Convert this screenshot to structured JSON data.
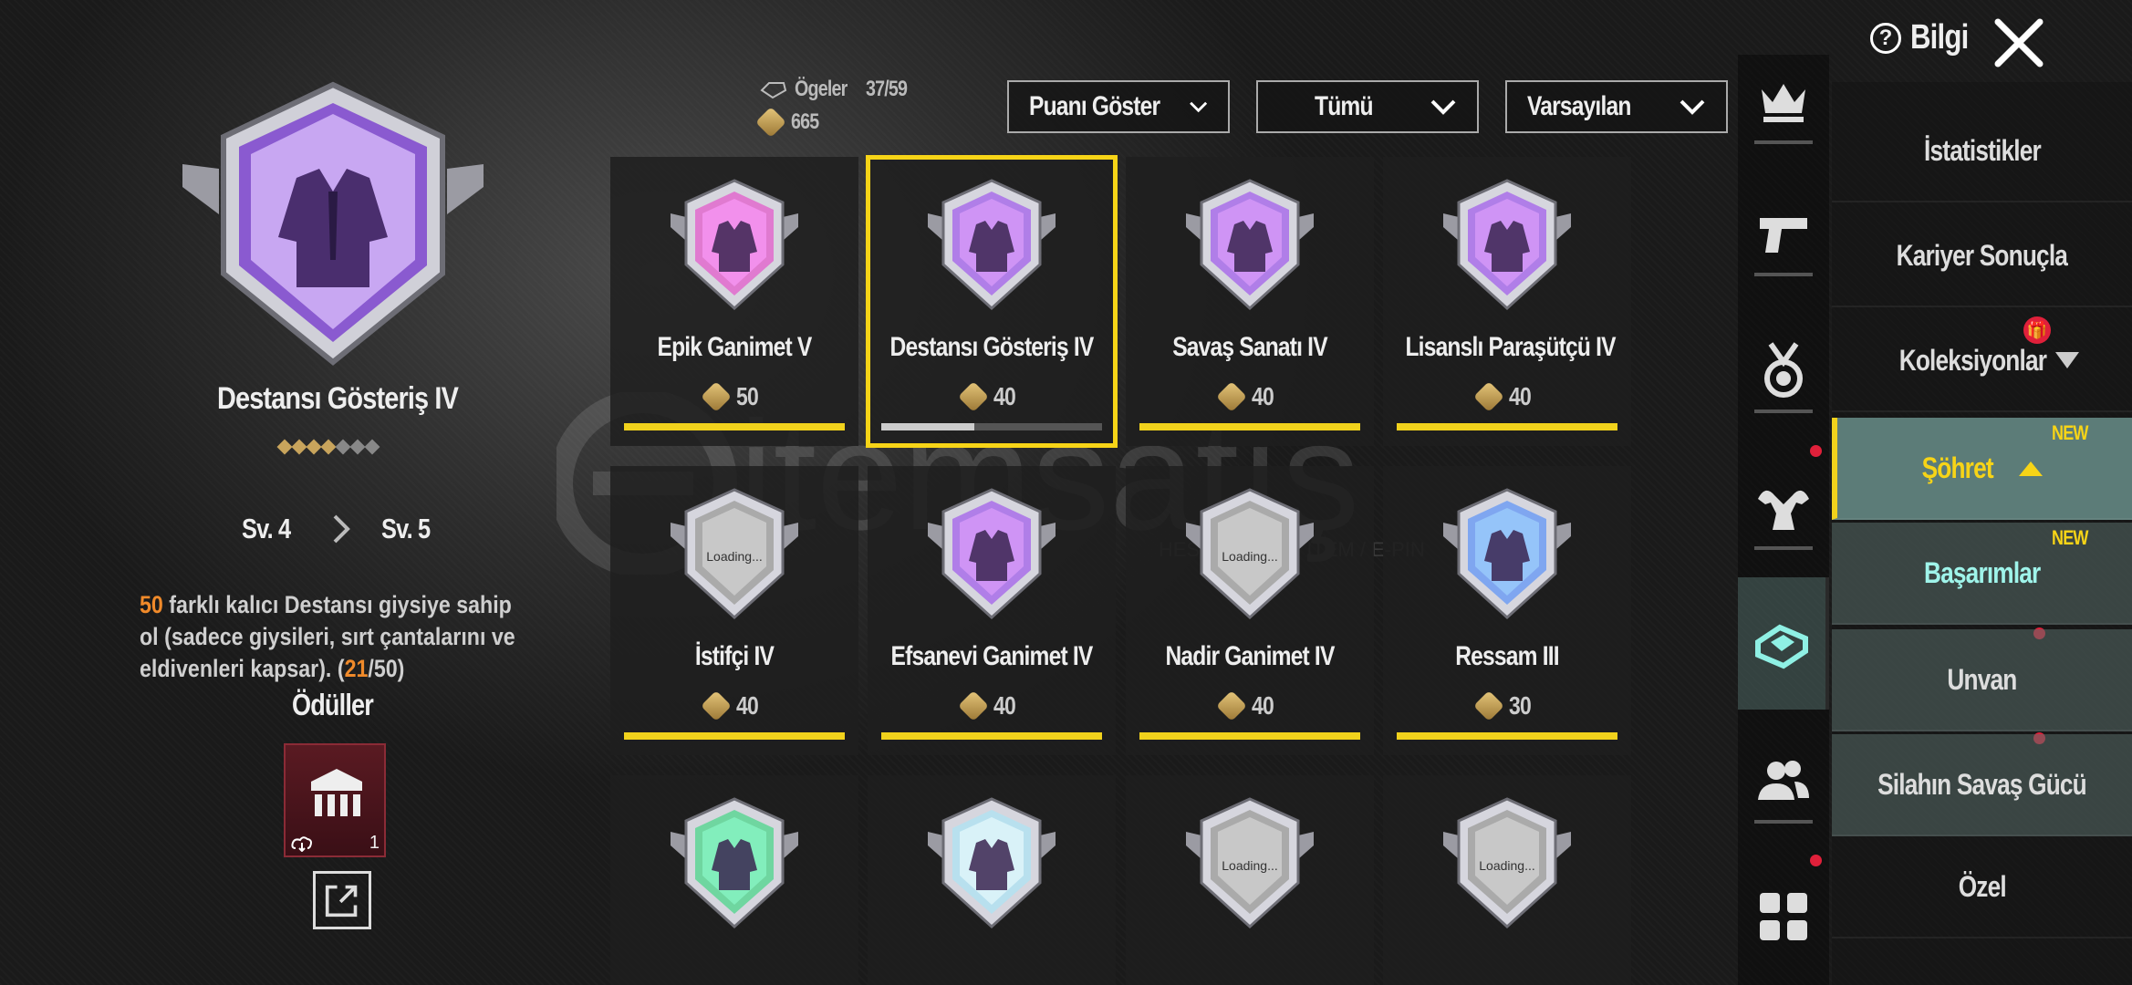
{
  "header": {
    "info_label": "Bilgi"
  },
  "selected": {
    "name": "Destansı Gösteriş IV",
    "level_from": "Sv. 4",
    "level_to": "Sv. 5",
    "desc_count": "50",
    "desc_text": " farklı kalıcı Destansı giysiye sahip ol (sadece giysileri, sırt çantalarını ve eldivenleri kapsar). (",
    "desc_progress": "21",
    "desc_total": "/50)",
    "rewards_title": "Ödüller",
    "reward_count": "1"
  },
  "stats": {
    "items_label": "Ögeler",
    "items_value": "37/59",
    "points_value": "665"
  },
  "filters": {
    "score": "Puanı Göster",
    "all": "Tümü",
    "sort": "Varsayılan"
  },
  "cards": [
    {
      "name": "Epik Ganimet V",
      "points": "50",
      "progress": 1.0,
      "color": "#e07ad0"
    },
    {
      "name": "Destansı Gösteriş IV",
      "points": "40",
      "progress": 0.42,
      "color": "#b07ee8"
    },
    {
      "name": "Savaş Sanatı IV",
      "points": "40",
      "progress": 1.0,
      "color": "#b07ee8"
    },
    {
      "name": "Lisanslı Paraşütçü IV",
      "points": "40",
      "progress": 1.0,
      "color": "#b07ee8"
    },
    {
      "name": "İstifçi IV",
      "points": "40",
      "progress": 1.0,
      "color": "#aaaaaa",
      "loading": "Loading..."
    },
    {
      "name": "Efsanevi Ganimet IV",
      "points": "40",
      "progress": 1.0,
      "color": "#b07ee8"
    },
    {
      "name": "Nadir Ganimet IV",
      "points": "40",
      "progress": 1.0,
      "color": "#aaaaaa",
      "loading": "Loading..."
    },
    {
      "name": "Ressam III",
      "points": "30",
      "progress": 1.0,
      "color": "#7fa6f0"
    },
    {
      "name": "",
      "points": "",
      "color": "#6fd6a0"
    },
    {
      "name": "",
      "points": "",
      "color": "#b8e0ee"
    },
    {
      "name": "",
      "points": "",
      "color": "#aaaaaa",
      "loading": "Loading..."
    },
    {
      "name": "",
      "points": "",
      "color": "#aaaaaa",
      "loading": "Loading..."
    }
  ],
  "menu": {
    "items": [
      "İstatistikler",
      "Kariyer Sonuçla",
      "Koleksiyonlar",
      "Şöhret",
      "Başarımlar",
      "Unvan",
      "Silahın Savaş Gücü",
      "Özel"
    ],
    "new_label": "NEW"
  },
  "watermark": {
    "brand": "itemsatış",
    "tag": "HESAP / SKIN / ITEM / E-PIN"
  }
}
